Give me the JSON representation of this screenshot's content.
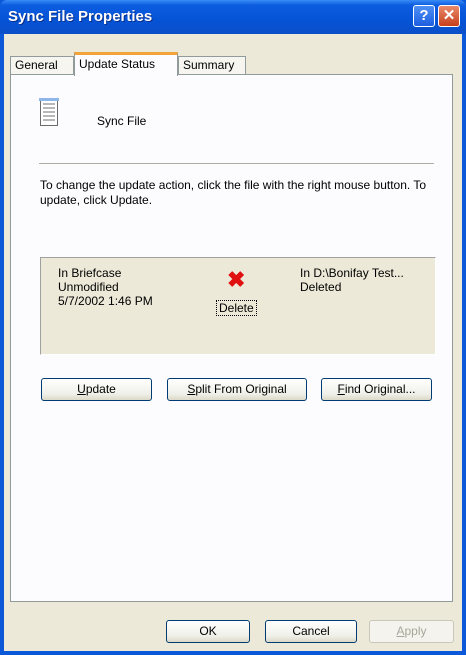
{
  "window": {
    "title": "Sync File Properties"
  },
  "title_buttons": [
    {
      "icon": "help-icon",
      "glyph": "?"
    },
    {
      "icon": "close-icon",
      "glyph": "✕"
    }
  ],
  "tabs": [
    {
      "label": "General"
    },
    {
      "label": "Update Status"
    },
    {
      "label": "Summary"
    }
  ],
  "active_tab": "Update Status",
  "file": {
    "name": "Sync File",
    "icon": "document-icon"
  },
  "description": "To change the update action, click the file with the right mouse button. To update, click Update.",
  "status": {
    "left": {
      "line1": "In Briefcase",
      "line2": "Unmodified",
      "line3": "5/7/2002 1:46 PM"
    },
    "action_icon": "red-x-icon",
    "action_glyph": "✖",
    "action_label": "Delete",
    "right": {
      "line1": "In D:\\Bonifay Test...",
      "line2": "Deleted"
    }
  },
  "buttons": {
    "update": {
      "prefix": "",
      "underlined": "U",
      "suffix": "pdate"
    },
    "split": {
      "prefix": "",
      "underlined": "S",
      "suffix": "plit From Original"
    },
    "find": {
      "prefix": "",
      "underlined": "F",
      "suffix": "ind Original..."
    }
  },
  "footer": {
    "ok": "OK",
    "cancel": "Cancel",
    "apply": {
      "prefix": "",
      "underlined": "A",
      "suffix": "pply"
    }
  },
  "colors": {
    "titlebar": "#0553d6",
    "dialog_bg": "#ece9d8",
    "action_red": "#e01010"
  }
}
